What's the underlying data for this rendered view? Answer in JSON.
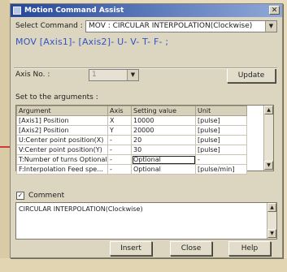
{
  "window": {
    "title": "Motion Command Assist",
    "close_glyph": "✕"
  },
  "command": {
    "label": "Select Command :",
    "selected": "MOV : CIRCULAR INTERPOLATION(Clockwise)",
    "syntax": "MOV [Axis1]- [Axis2]- U- V- T- F- ;"
  },
  "axis_no": {
    "label": "Axis No. :",
    "value": "1"
  },
  "update_button": "Update",
  "args_label": "Set to the arguments :",
  "table": {
    "headers": [
      "Argument",
      "Axis",
      "Setting value",
      "Unit"
    ],
    "rows": [
      [
        "[Axis1] Position",
        "X",
        "10000",
        "[pulse]"
      ],
      [
        "[Axis2] Position",
        "Y",
        "20000",
        "[pulse]"
      ],
      [
        "U:Center point position(X)",
        "-",
        "20",
        "[pulse]"
      ],
      [
        "V:Center point position(Y)",
        "-",
        "30",
        "[pulse]"
      ],
      [
        "T:Number of turns Optional",
        "-",
        "Optional",
        "-"
      ],
      [
        "F:Interpolation Feed spe...",
        "-",
        "Optional",
        "[pulse/min]"
      ]
    ]
  },
  "comment": {
    "label": "Comment",
    "checked_glyph": "✓",
    "text": "CIRCULAR INTERPOLATION(Clockwise)"
  },
  "buttons": {
    "insert": "Insert",
    "close": "Close",
    "help": "Help"
  },
  "glyphs": {
    "combo_arrow": "▼",
    "scroll_up": "▲",
    "scroll_down": "▼"
  }
}
